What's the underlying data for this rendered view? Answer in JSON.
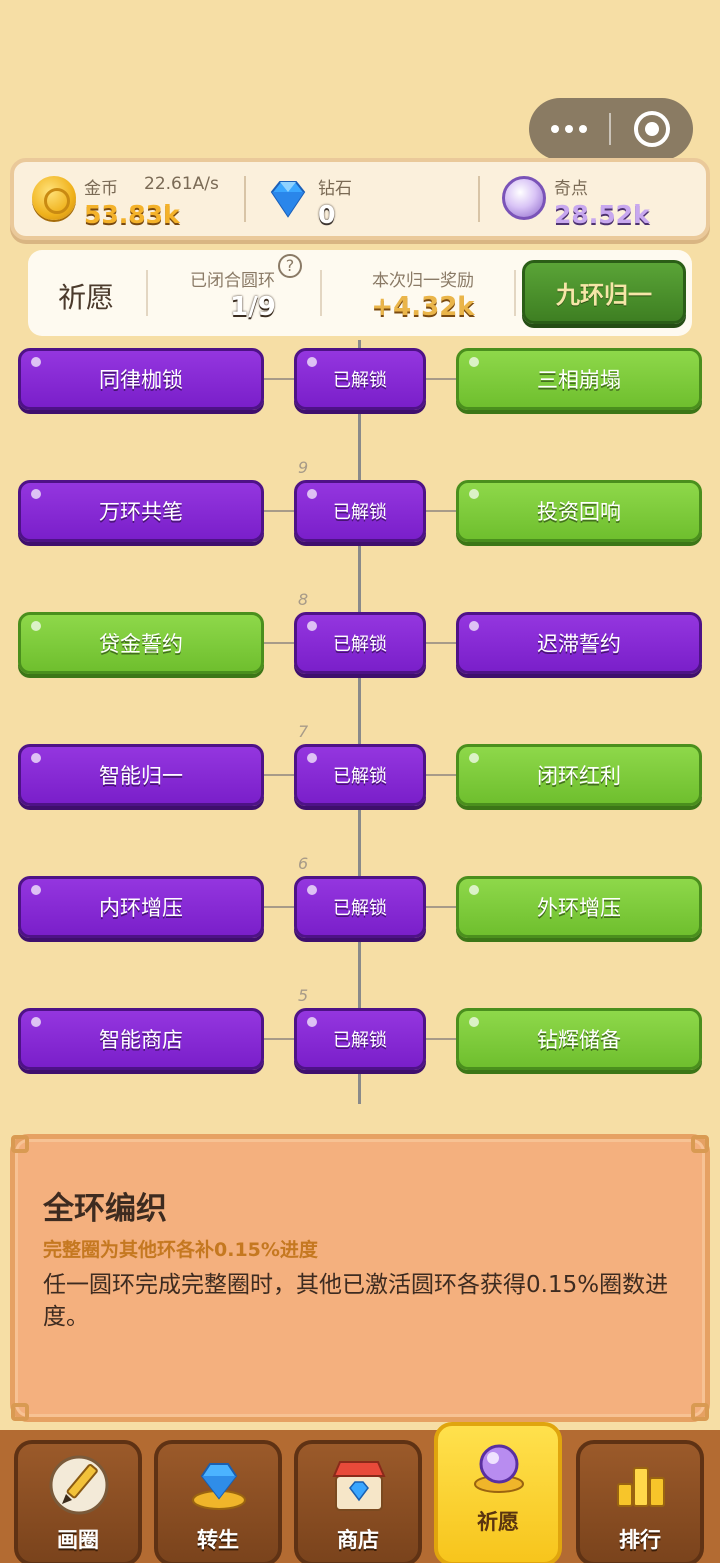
{
  "currency": {
    "gold": {
      "label": "金币",
      "rate": "22.61A/s",
      "value": "53.83k",
      "icon": "gold-coin-icon"
    },
    "diamond": {
      "label": "钻石",
      "value": "0",
      "icon": "diamond-icon"
    },
    "wonder": {
      "label": "奇点",
      "value": "28.52k",
      "icon": "wonder-orb-icon"
    }
  },
  "wish": {
    "title": "祈愿",
    "closed_label": "已闭合圆环",
    "closed_value": "1/9",
    "reward_label": "本次归一奖励",
    "reward_value": "+4.32k",
    "action_label": "九环归一"
  },
  "tree": {
    "rows": [
      {
        "tier": "",
        "left": {
          "label": "同律枷锁",
          "color": "purple"
        },
        "mid": "已解锁",
        "right": {
          "label": "三相崩塌",
          "color": "green"
        }
      },
      {
        "tier": "9",
        "left": {
          "label": "万环共笔",
          "color": "purple"
        },
        "mid": "已解锁",
        "right": {
          "label": "投资回响",
          "color": "green"
        }
      },
      {
        "tier": "8",
        "left": {
          "label": "贷金誓约",
          "color": "green"
        },
        "mid": "已解锁",
        "right": {
          "label": "迟滞誓约",
          "color": "purple"
        }
      },
      {
        "tier": "7",
        "left": {
          "label": "智能归一",
          "color": "purple"
        },
        "mid": "已解锁",
        "right": {
          "label": "闭环红利",
          "color": "green"
        }
      },
      {
        "tier": "6",
        "left": {
          "label": "内环增压",
          "color": "purple"
        },
        "mid": "已解锁",
        "right": {
          "label": "外环增压",
          "color": "green"
        }
      },
      {
        "tier": "5",
        "left": {
          "label": "智能商店",
          "color": "purple"
        },
        "mid": "已解锁",
        "right": {
          "label": "钻辉储备",
          "color": "green"
        }
      }
    ]
  },
  "info": {
    "title": "全环编织",
    "subtitle": "完整圈为其他环各补0.15%进度",
    "description": "任一圆环完成完整圈时，其他已激活圆环各获得0.15%圈数进度。"
  },
  "nav": {
    "items": [
      {
        "label": "画圈",
        "icon": "pencil-icon",
        "active": false
      },
      {
        "label": "转生",
        "icon": "rebirth-gem-icon",
        "active": false
      },
      {
        "label": "商店",
        "icon": "shop-icon",
        "active": false
      },
      {
        "label": "祈愿",
        "icon": "wish-orb-icon",
        "active": true
      },
      {
        "label": "排行",
        "icon": "ranking-icon",
        "active": false
      }
    ]
  },
  "colors": {
    "background": "#f6dea5",
    "node_purple": "#8a2ad5",
    "node_green": "#7fcb3a",
    "action_green": "#4a8f2a"
  }
}
